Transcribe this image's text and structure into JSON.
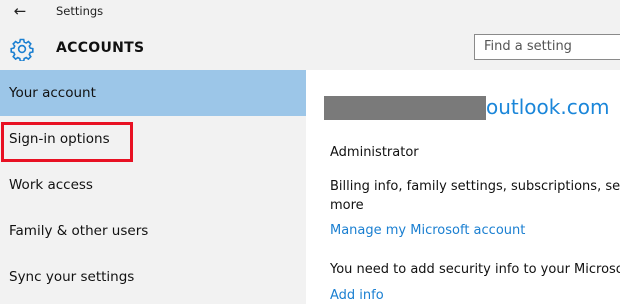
{
  "window": {
    "title": "Settings",
    "back_icon": "arrow-left-icon"
  },
  "header": {
    "icon": "gear-icon",
    "title": "ACCOUNTS",
    "search_placeholder": "Find a setting"
  },
  "sidebar": {
    "selected_index": 0,
    "highlighted_index": 1,
    "highlight_color": "#e81123",
    "selected_color": "#9cc6e8",
    "items": [
      {
        "label": "Your account"
      },
      {
        "label": "Sign-in options"
      },
      {
        "label": "Work access"
      },
      {
        "label": "Family & other users"
      },
      {
        "label": "Sync your settings"
      }
    ]
  },
  "account": {
    "email_visible_part": "outlook.com",
    "role": "Administrator",
    "billing_info": "Billing info, family settings, subscriptions, secu\nmore",
    "manage_link": "Manage my Microsoft account",
    "security_notice": "You need to add security info to your Microsoft",
    "add_info_link": "Add info"
  },
  "colors": {
    "accent": "#1a7fd1",
    "sidebar_bg": "#f2f2f2",
    "redaction": "#7a7a7a"
  }
}
